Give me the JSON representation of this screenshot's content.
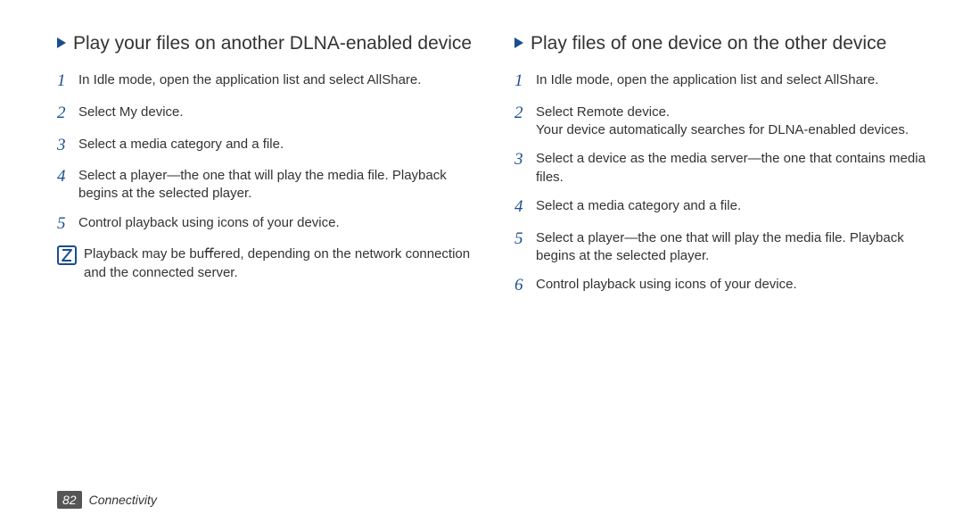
{
  "left": {
    "heading": "Play your ﬁles on another DLNA-enabled device",
    "steps": [
      "In Idle mode, open the application list and select AllShare.",
      "Select My device.",
      "Select a media category and a ﬁle.",
      "Select a player—the one that will play the media ﬁle. Playback begins at the selected player.",
      "Control playback using icons of your device."
    ],
    "note": "Playback may be buﬀered, depending on the network connection and the connected server."
  },
  "right": {
    "heading": "Play ﬁles of one device on the other device",
    "steps": [
      "In Idle mode, open the application list and select AllShare.",
      "Select Remote device.\nYour device automatically searches for DLNA-enabled devices.",
      "Select a device as the media server—the one that contains media ﬁles.",
      "Select a media category and a ﬁle.",
      "Select a player—the one that will play the media ﬁle. Playback begins at the selected player.",
      "Control playback using icons of your device."
    ]
  },
  "footer": {
    "page": "82",
    "section": "Connectivity"
  }
}
